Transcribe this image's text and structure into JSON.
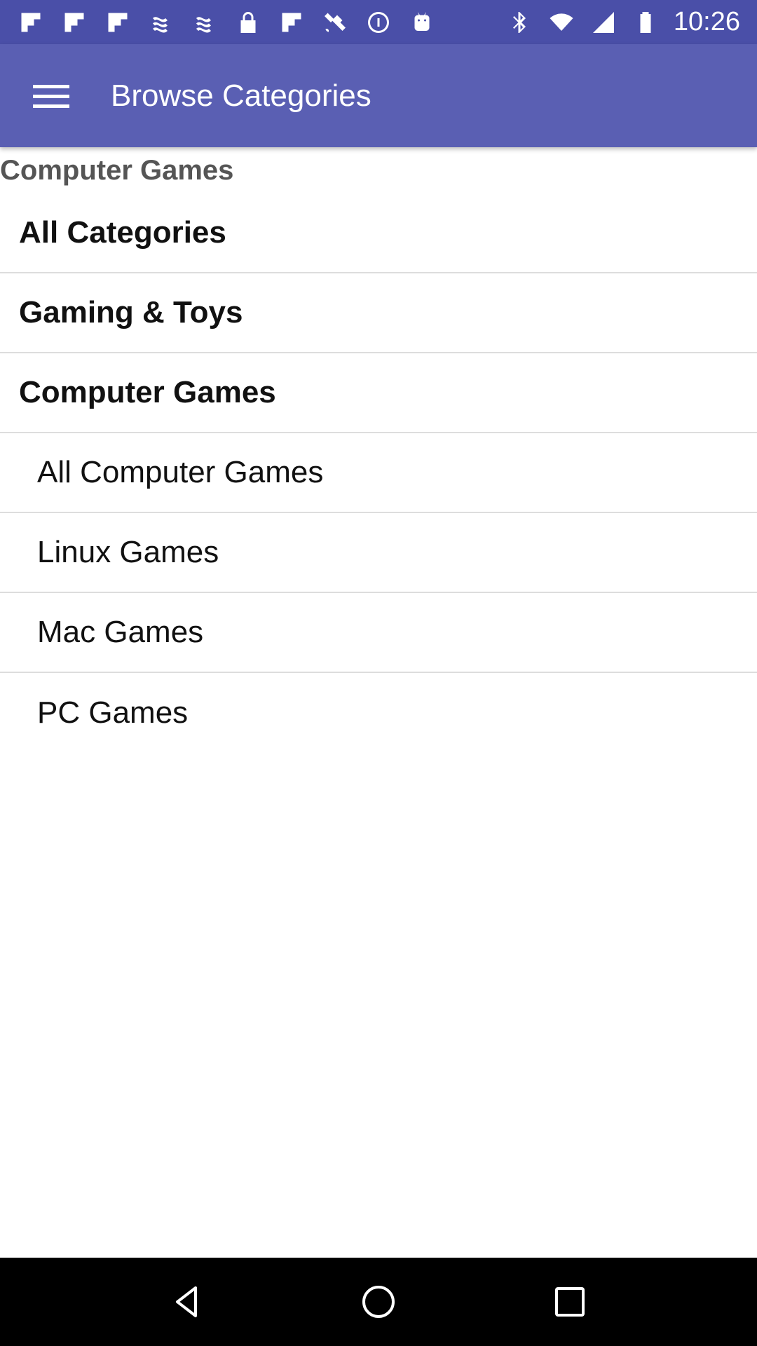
{
  "status_bar": {
    "time": "10:26",
    "left_icons": [
      "flipboard-icon",
      "flipboard-icon",
      "flipboard-icon",
      "signal-wave-icon",
      "signal-wave-icon",
      "lock-icon",
      "flipboard-icon",
      "satellite-icon",
      "info-icon",
      "android-icon"
    ],
    "right_icons": [
      "bluetooth-icon",
      "wifi-icon",
      "signal-icon",
      "battery-icon"
    ]
  },
  "app_bar": {
    "title": "Browse Categories",
    "color": "#5a5fb3"
  },
  "section_header": "Computer Games",
  "categories": [
    {
      "label": "All Categories",
      "level": "top"
    },
    {
      "label": "Gaming & Toys",
      "level": "top"
    },
    {
      "label": "Computer Games",
      "level": "top"
    },
    {
      "label": "All Computer Games",
      "level": "sub"
    },
    {
      "label": "Linux Games",
      "level": "sub"
    },
    {
      "label": "Mac Games",
      "level": "sub"
    },
    {
      "label": "PC Games",
      "level": "sub"
    }
  ],
  "nav_bar": {
    "buttons": [
      "back-icon",
      "home-icon",
      "recents-icon"
    ]
  }
}
